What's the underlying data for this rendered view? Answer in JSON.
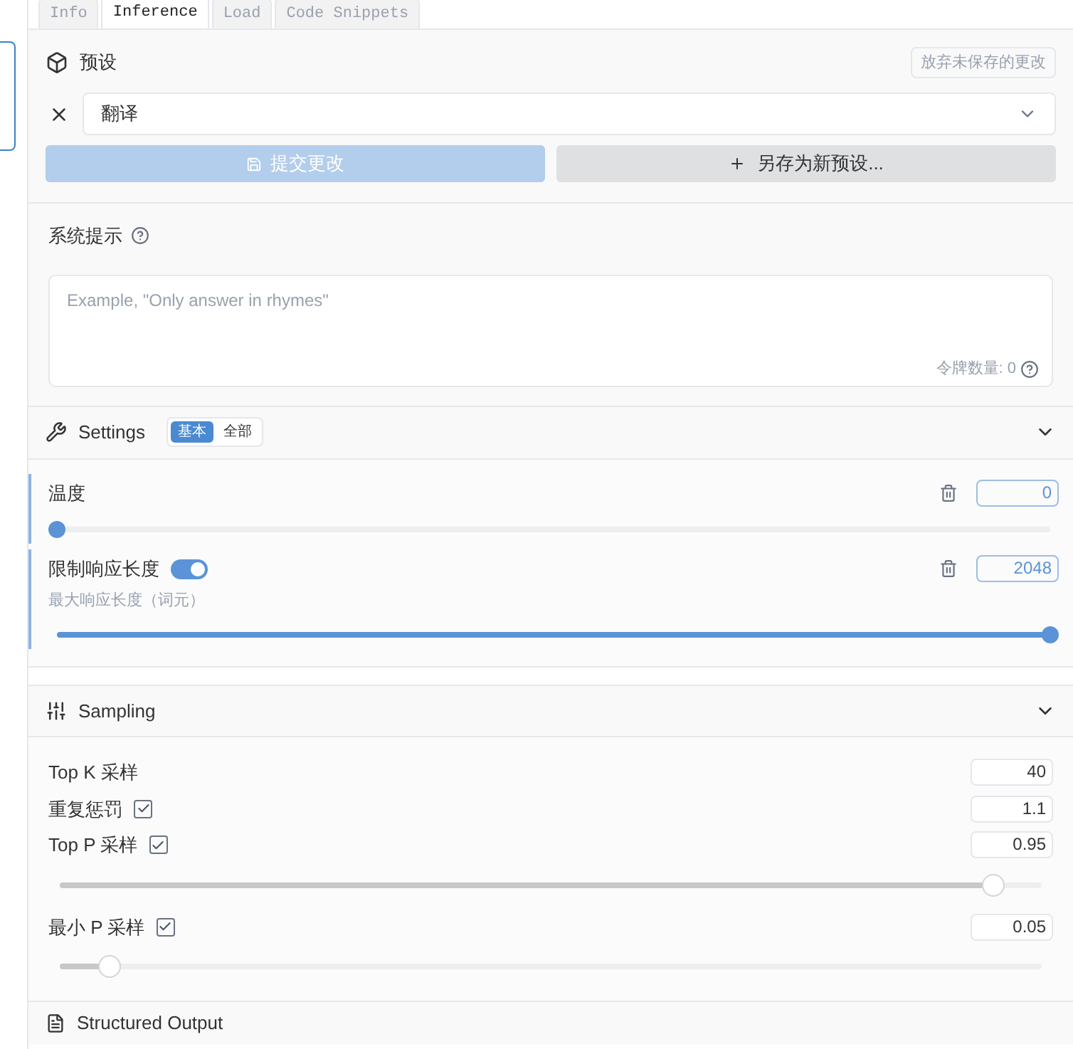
{
  "tabs": [
    {
      "label": "Info",
      "selected": false
    },
    {
      "label": "Inference",
      "selected": true
    },
    {
      "label": "Load",
      "selected": false
    },
    {
      "label": "Code Snippets",
      "selected": false
    }
  ],
  "preset": {
    "title": "预设",
    "discard_button": "放弃未保存的更改",
    "selected_preset": "翻译",
    "commit_button": {
      "label": "提交更改",
      "disabled": true
    },
    "save_as_button": "另存为新预设..."
  },
  "system_prompt": {
    "title": "系统提示",
    "placeholder": "Example, \"Only answer in rhymes\"",
    "token_count": "令牌数量: 0"
  },
  "settings": {
    "title": "Settings",
    "modes": [
      {
        "label": "基本",
        "selected": true
      },
      {
        "label": "全部",
        "selected": false
      }
    ],
    "params": [
      {
        "kind": "slider",
        "label": "温度",
        "value": "0",
        "level": 0
      },
      {
        "kind": "toggle_slider",
        "label": "限制响应长度",
        "on": true,
        "hint": "最大响应长度（词元）",
        "value": "2048",
        "level": 1
      }
    ]
  },
  "sampling": {
    "title": "Sampling",
    "params": [
      {
        "kind": "field",
        "label": "Top K 采样",
        "value": "40"
      },
      {
        "kind": "checkbox",
        "label": "重复惩罚",
        "checked": true,
        "value": "1.1"
      },
      {
        "kind": "slider",
        "label": "Top P 采样",
        "checked": true,
        "value": "0.95",
        "level": 0.95
      },
      {
        "kind": "slider",
        "label": "最小 P 采样",
        "checked": true,
        "value": "0.05",
        "level": 0.05
      }
    ]
  },
  "structured_output": {
    "title": "Structured Output"
  }
}
